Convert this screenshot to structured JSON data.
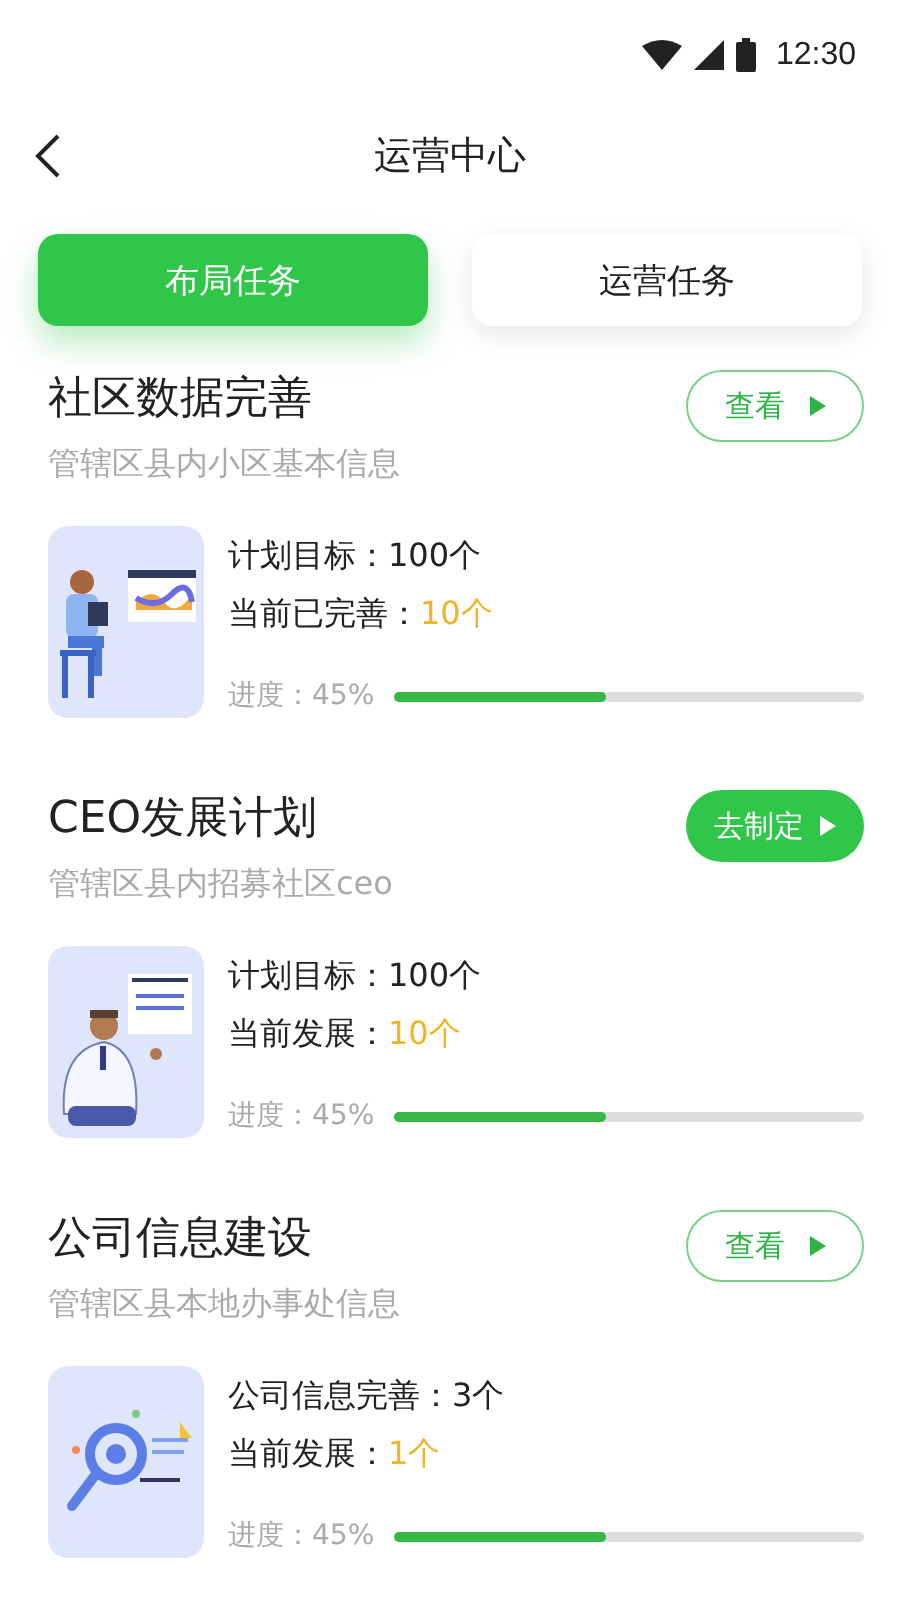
{
  "status_bar": {
    "time": "12:30"
  },
  "header": {
    "title": "运营中心"
  },
  "tabs": [
    {
      "label": "布局任务",
      "selected": true
    },
    {
      "label": "运营任务",
      "selected": false
    }
  ],
  "tasks": [
    {
      "title": "社区数据完善",
      "subtitle": "管辖区县内小区基本信息",
      "button": {
        "label": "查看",
        "kind": "outline"
      },
      "stats": [
        {
          "label": "计划目标：",
          "value": "100个",
          "highlight": false
        },
        {
          "label": "当前已完善：",
          "value": "10个",
          "highlight": true
        }
      ],
      "progress_label": "进度：45%",
      "level": 0.45
    },
    {
      "title": "CEO发展计划",
      "subtitle": "管辖区县内招募社区ceo",
      "button": {
        "label": "去制定",
        "kind": "filled"
      },
      "stats": [
        {
          "label": "计划目标：",
          "value": "100个",
          "highlight": false
        },
        {
          "label": "当前发展：",
          "value": "10个",
          "highlight": true
        }
      ],
      "progress_label": "进度：45%",
      "level": 0.45
    },
    {
      "title": "公司信息建设",
      "subtitle": "管辖区县本地办事处信息",
      "button": {
        "label": "查看",
        "kind": "outline"
      },
      "stats": [
        {
          "label": "公司信息完善：",
          "value": "3个",
          "highlight": false
        },
        {
          "label": "当前发展：",
          "value": "1个",
          "highlight": true
        }
      ],
      "progress_label": "进度：45%",
      "level": 0.45
    }
  ]
}
